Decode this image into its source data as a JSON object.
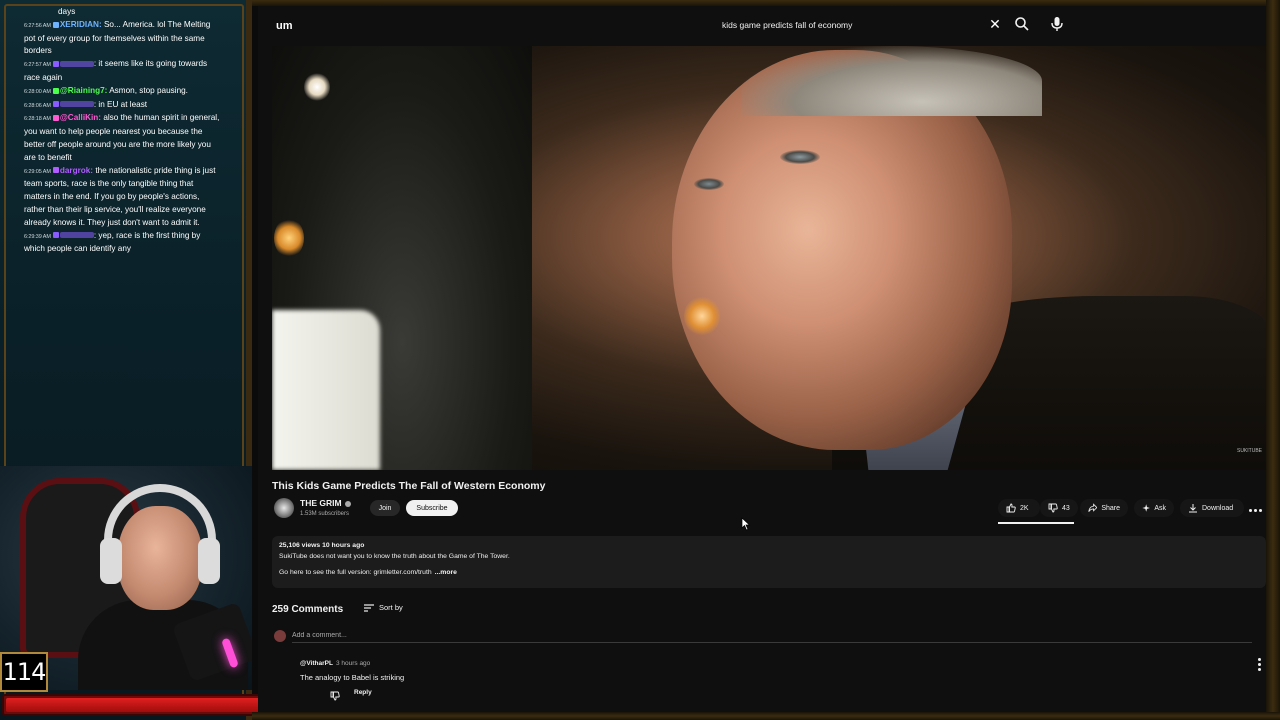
{
  "chat": {
    "messages": [
      {
        "time": "",
        "user": "",
        "user_color": "#ffffff",
        "text": "days"
      },
      {
        "time": "6:27:56 AM",
        "user": "XERIDIAN:",
        "user_color": "#6fb3ff",
        "text": "So... America. lol The Melting pot of every group for themselves within the same borders"
      },
      {
        "time": "6:27:57 AM",
        "user": "",
        "user_color": "#8a5cff",
        "text": ": it seems like its going towards race again"
      },
      {
        "time": "6:28:00 AM",
        "user": "@Riaining7:",
        "user_color": "#4cff4c",
        "text": "Asmon, stop pausing."
      },
      {
        "time": "6:28:06 AM",
        "user": "",
        "user_color": "#8a5cff",
        "text": ": in EU at least"
      },
      {
        "time": "6:28:18 AM",
        "user": "@CalliKin:",
        "user_color": "#ff5ad1",
        "text": "also the human spirit in general, you want to help people nearest you because the better off people around you are the more likely you are to benefit"
      },
      {
        "time": "6:29:05 AM",
        "user": "dargrok:",
        "user_color": "#b05cff",
        "text": "the nationalistic pride thing is just team sports, race is the only tangible thing that matters in the end. If you go by people's actions, rather than their lip service, you'll realize everyone already knows it. They just don't want to admit it."
      },
      {
        "time": "6:29:39 AM",
        "user": "",
        "user_color": "#8a5cff",
        "text": ": yep, race is the first thing by which people can identify any"
      }
    ]
  },
  "stream": {
    "counter": "114",
    "hp_fraction": 0.97
  },
  "search": {
    "value": "kids game predicts fall of economy",
    "placeholder": "Search"
  },
  "youtube": {
    "logo_text": "um",
    "watermark": "SUKITUBE"
  },
  "video": {
    "title": "This Kids Game Predicts The Fall of Western Economy",
    "channel": "THE GRIM",
    "subscribers": "1.53M subscribers",
    "join_label": "Join",
    "subscribe_label": "Subscribe",
    "likes": "2K",
    "dislikes": "43",
    "share_label": "Share",
    "ask_label": "Ask",
    "download_label": "Download",
    "views_time": "25,106 views  10 hours ago",
    "description_line1": "SukiTube does not want you to know the truth about the Game of The Tower.",
    "description_line2": "Go here to see the full version: grimletter.com/truth",
    "more_label": "...more"
  },
  "comments": {
    "count_label": "259 Comments",
    "sort_label": "Sort by",
    "add_placeholder": "Add a comment...",
    "items": [
      {
        "author": "@VitharPL",
        "time": "3 hours ago",
        "text": "The analogy to Babel is striking",
        "reply_label": "Reply"
      }
    ]
  },
  "colors": {
    "accent_red": "#e02020",
    "frame_gold": "#b08a3a",
    "yt_bg": "#0f0f0f"
  }
}
